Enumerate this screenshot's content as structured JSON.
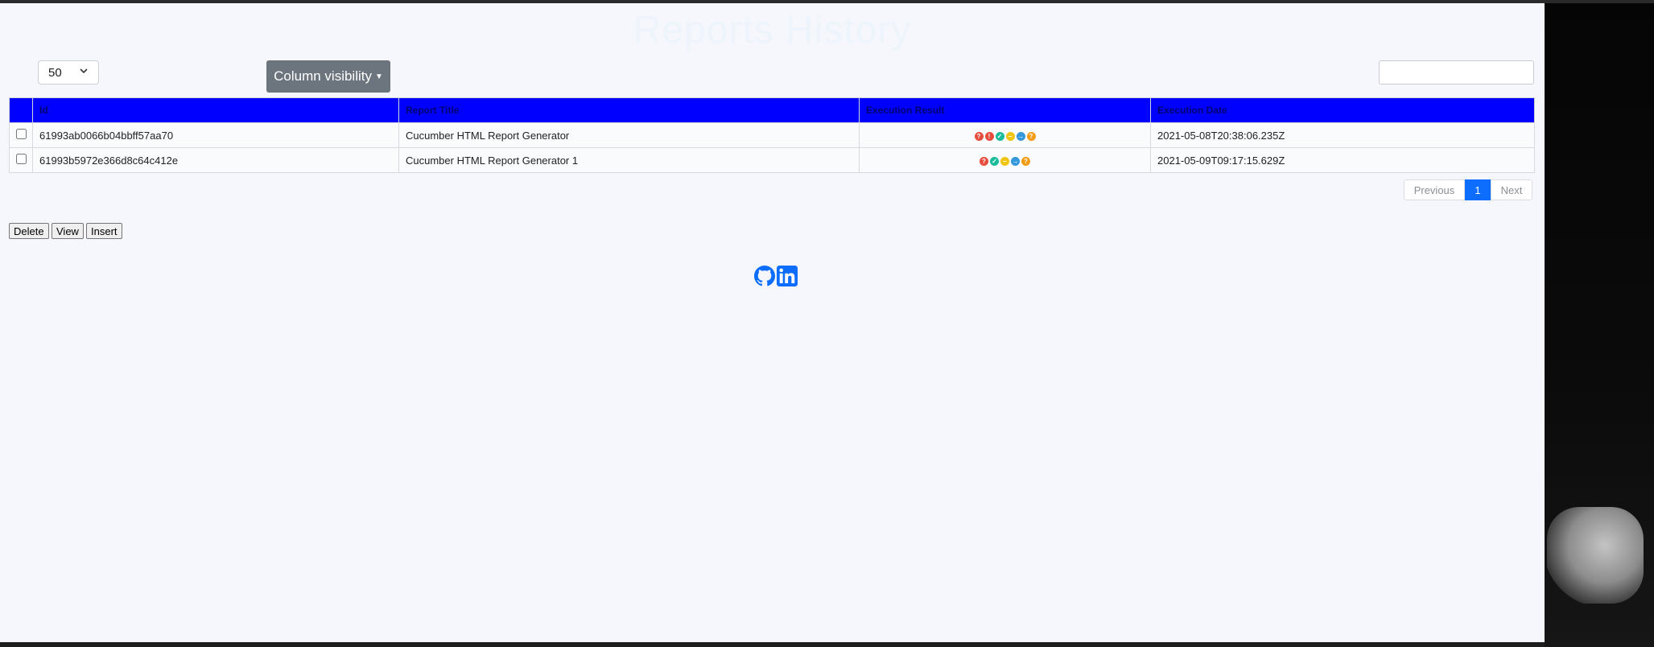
{
  "page": {
    "title": "Reports History"
  },
  "controls": {
    "length_value": "50",
    "colvis_label": "Column visibility",
    "search_value": ""
  },
  "table": {
    "headers": [
      "Id",
      "Report Title",
      "Execution Result",
      "Execution Date"
    ],
    "rows": [
      {
        "id": "61993ab0066b04bbff57aa70",
        "title": "Cucumber HTML Report Generator",
        "result_icons": [
          {
            "icon": "question-icon",
            "color": "#e74c3c",
            "glyph": "?"
          },
          {
            "icon": "exclamation-icon",
            "color": "#e74c3c",
            "glyph": "!"
          },
          {
            "icon": "check-icon",
            "color": "#1abc9c",
            "glyph": "✓"
          },
          {
            "icon": "pending-icon",
            "color": "#f1c40f",
            "glyph": "‒"
          },
          {
            "icon": "arrow-right-icon",
            "color": "#3498db",
            "glyph": "→"
          },
          {
            "icon": "question-icon",
            "color": "#f39c12",
            "glyph": "?"
          }
        ],
        "date": "2021-05-08T20:38:06.235Z"
      },
      {
        "id": "61993b5972e366d8c64c412e",
        "title": "Cucumber HTML Report Generator 1",
        "result_icons": [
          {
            "icon": "question-icon",
            "color": "#e74c3c",
            "glyph": "?"
          },
          {
            "icon": "check-icon",
            "color": "#1abc9c",
            "glyph": "✓"
          },
          {
            "icon": "pending-icon",
            "color": "#f1c40f",
            "glyph": "‒"
          },
          {
            "icon": "arrow-right-icon",
            "color": "#3498db",
            "glyph": "→"
          },
          {
            "icon": "question-icon",
            "color": "#f39c12",
            "glyph": "?"
          }
        ],
        "date": "2021-05-09T09:17:15.629Z"
      }
    ]
  },
  "pagination": {
    "previous": "Previous",
    "current": "1",
    "next": "Next"
  },
  "actions": {
    "delete": "Delete",
    "view": "View",
    "insert": "Insert"
  },
  "colors": {
    "header_bg": "#0000ff",
    "active_page": "#0d6efd",
    "colvis_bg": "#6c757d",
    "page_bg": "#f5f7fd"
  },
  "footer": {
    "icons": [
      "github-icon",
      "linkedin-icon"
    ]
  }
}
